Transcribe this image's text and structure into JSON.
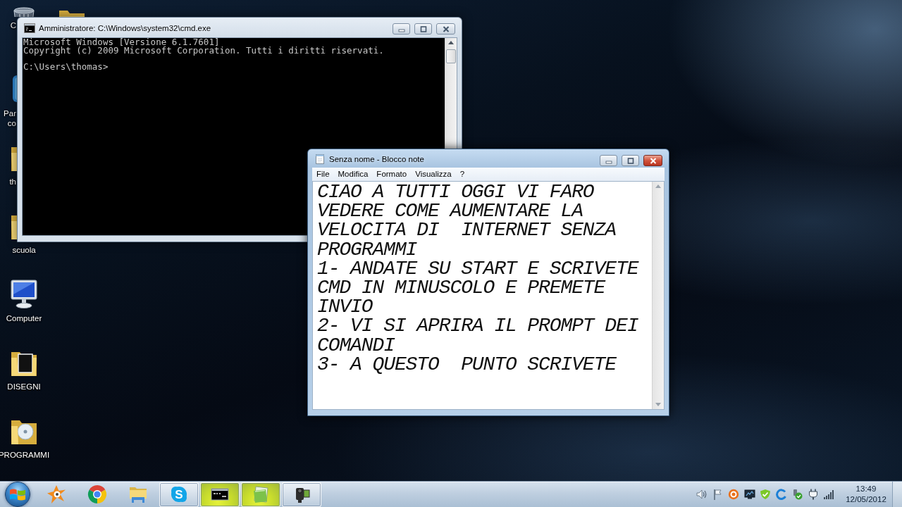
{
  "desktop": {
    "icons": [
      {
        "kind": "bin",
        "label": "C"
      },
      {
        "kind": "tile",
        "label": "Par\nco"
      },
      {
        "kind": "folder",
        "label": "th"
      },
      {
        "kind": "folder",
        "label": "scuola"
      },
      {
        "kind": "computer",
        "label": "Computer"
      },
      {
        "kind": "folder-photo",
        "label": "DISEGNI"
      },
      {
        "kind": "folder-disc",
        "label": "PROGRAMMI"
      },
      {
        "kind": "folder"
      }
    ]
  },
  "cmd_window": {
    "title": "Amministratore: C:\\Windows\\system32\\cmd.exe",
    "active": false,
    "text": "Microsoft Windows [Versione 6.1.7601]\nCopyright (c) 2009 Microsoft Corporation. Tutti i diritti riservati.\n\nC:\\Users\\thomas>"
  },
  "notepad": {
    "title": "Senza nome - Blocco note",
    "active": true,
    "menu": [
      "File",
      "Modifica",
      "Formato",
      "Visualizza",
      "?"
    ],
    "text": "CIAO A TUTTI OGGI VI FARO\nVEDERE COME AUMENTARE LA\nVELOCITA DI  INTERNET SENZA\nPROGRAMMI\n1- ANDATE SU START E SCRIVETE\nCMD IN MINUSCOLO E PREMETE\nINVIO\n2- VI SI APRIRA IL PROMPT DEI\nCOMANDI\n3- A QUESTO  PUNTO SCRIVETE"
  },
  "taskbar": {
    "items": [
      {
        "kind": "antivirus",
        "running": false,
        "highlighted": false
      },
      {
        "kind": "browser",
        "running": false,
        "highlighted": false
      },
      {
        "kind": "folders",
        "running": false,
        "highlighted": false
      },
      {
        "kind": "messenger",
        "glyph": "S",
        "running": true,
        "highlighted": false
      },
      {
        "kind": "console",
        "running": true,
        "highlighted": true
      },
      {
        "kind": "notepad",
        "running": true,
        "highlighted": true
      },
      {
        "kind": "camera",
        "running": true,
        "highlighted": false
      }
    ],
    "clock": {
      "time": "13:49",
      "date": "12/05/2012"
    }
  }
}
